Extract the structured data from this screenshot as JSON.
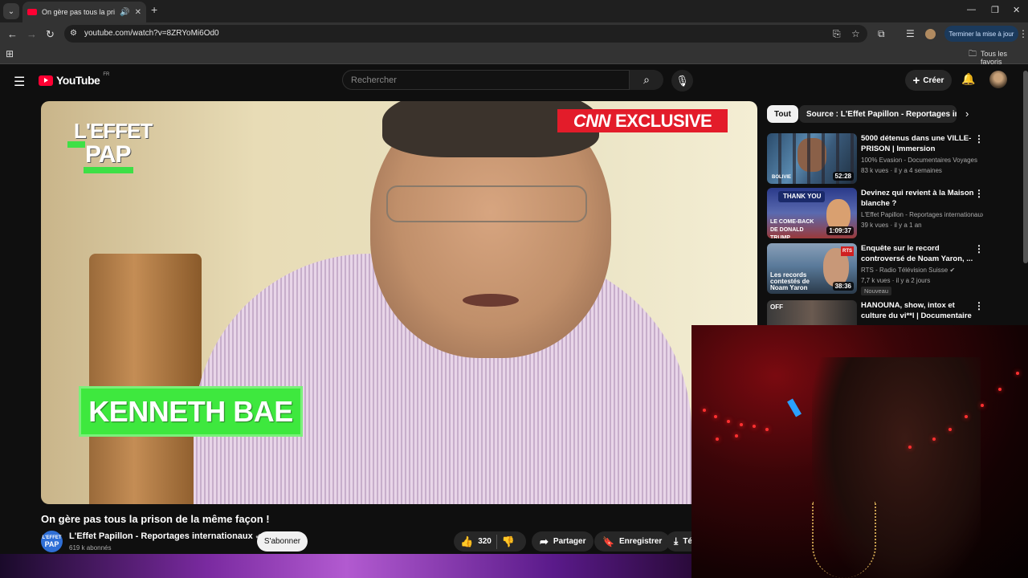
{
  "browser": {
    "tab_title": "On gère pas tous la prison de la même façon ! - YouTube",
    "new_tab_icon": "+",
    "url": "youtube.com/watch?v=8ZRYoMi6Od0",
    "update_button": "Terminer la mise à jour",
    "bookmarks_folder": "Tous les favoris"
  },
  "youtube": {
    "logo_text": "YouTube",
    "region": "FR",
    "search_placeholder": "Rechercher",
    "create_label": "Créer"
  },
  "video": {
    "overlay_logo_line1": "L'EFFET",
    "overlay_logo_line2": "PAP",
    "cnn_mark": "CNN",
    "cnn_label": "EXCLUSIVE",
    "lower_third": "KENNETH BAE",
    "title": "On gère pas tous la prison de la même façon !",
    "channel_logo_line1": "L'EFFET",
    "channel_logo_line2": "PAP",
    "channel_name": "L'Effet Papillon - Reportages internationaux",
    "subscribers": "619 k abonnés",
    "subscribe_label": "S'abonner",
    "likes": "320",
    "share_label": "Partager",
    "save_label": "Enregistrer",
    "download_label": "Té"
  },
  "sidebar": {
    "chips": [
      "Tout",
      "Source : L'Effet Papillon - Reportages internationaux"
    ],
    "recommendations": [
      {
        "title": "5000 détenus dans une VILLE-PRISON | Immersion",
        "channel": "100% Evasion - Documentaires Voyages",
        "meta": "83 k vues · il y a 4 semaines",
        "duration": "52:28",
        "thumb_text": "BOLIVIE"
      },
      {
        "title": "Devinez qui revient à la Maison blanche ?",
        "channel": "L'Effet Papillon - Reportages internationaux",
        "meta": "39 k vues · il y a 1 an",
        "duration": "1:09:37",
        "thumb_text": "THANK YOU",
        "thumb_text2": "LE COME-BACK DE DONALD TRUMP"
      },
      {
        "title": "Enquête sur le record controversé de Noam Yaron, ...",
        "channel": "RTS - Radio Télévision Suisse",
        "meta": "7,7 k vues · il y a 2 jours",
        "duration": "38:36",
        "badge": "Nouveau",
        "thumb_text": "Les records contestés de Noam Yaron",
        "thumb_tag": "RTS"
      },
      {
        "title": "HANOUNA, show, intox et culture du vi**l | Documentaire |...",
        "thumb_text": "OFF"
      }
    ]
  }
}
